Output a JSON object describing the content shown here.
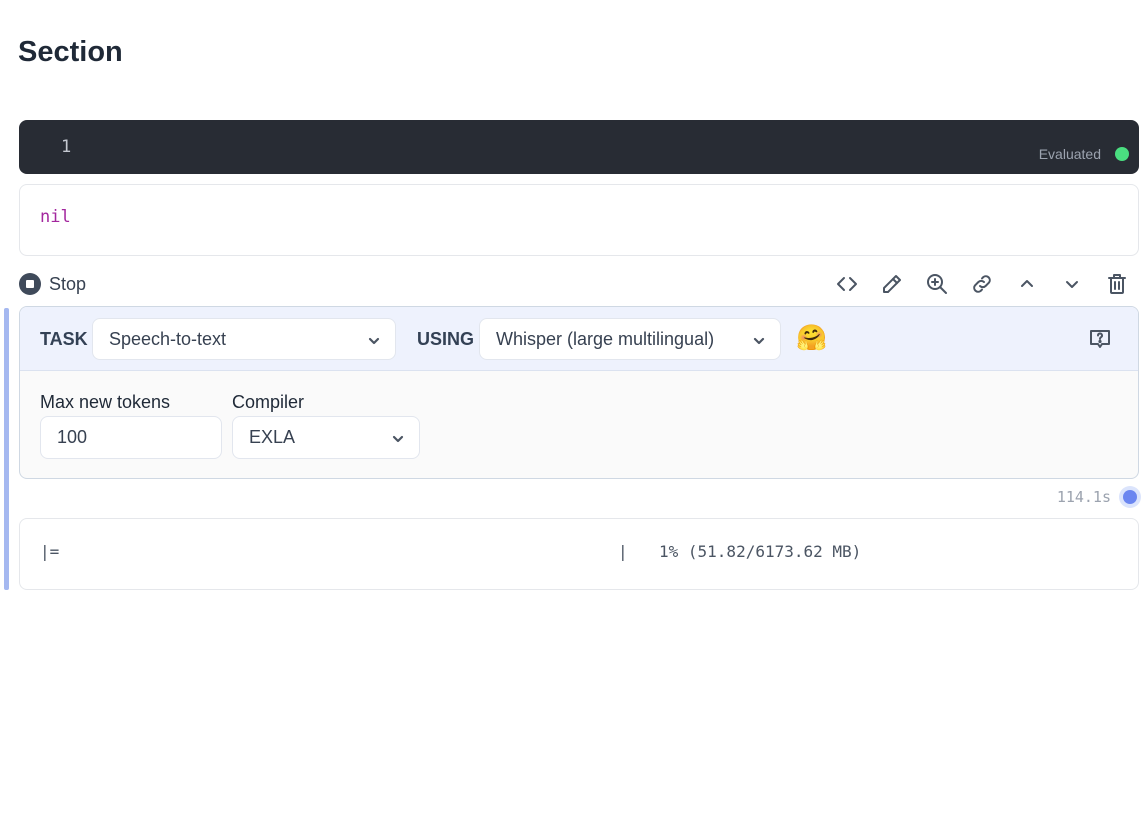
{
  "section": {
    "title": "Section"
  },
  "code_cell": {
    "line_number": "1",
    "status": "Evaluated",
    "status_color": "#4ade80"
  },
  "output": {
    "text": "nil"
  },
  "toolbar": {
    "stop_label": "Stop",
    "icons": [
      "code-icon",
      "pencil-icon",
      "zoom-in-icon",
      "link-icon",
      "chevron-up-icon",
      "chevron-down-icon",
      "trash-icon"
    ]
  },
  "smart_cell": {
    "task_label": "TASK",
    "task_value": "Speech-to-text",
    "using_label": "USING",
    "using_value": "Whisper (large multilingual)",
    "emoji": "🤗",
    "max_tokens_label": "Max new tokens",
    "max_tokens_value": "100",
    "compiler_label": "Compiler",
    "compiler_value": "EXLA"
  },
  "eval_timer": {
    "text": "114.1s"
  },
  "progress": {
    "bar": "|=",
    "separator": "|",
    "percent_text": "1% (51.82/6173.62 MB)"
  }
}
